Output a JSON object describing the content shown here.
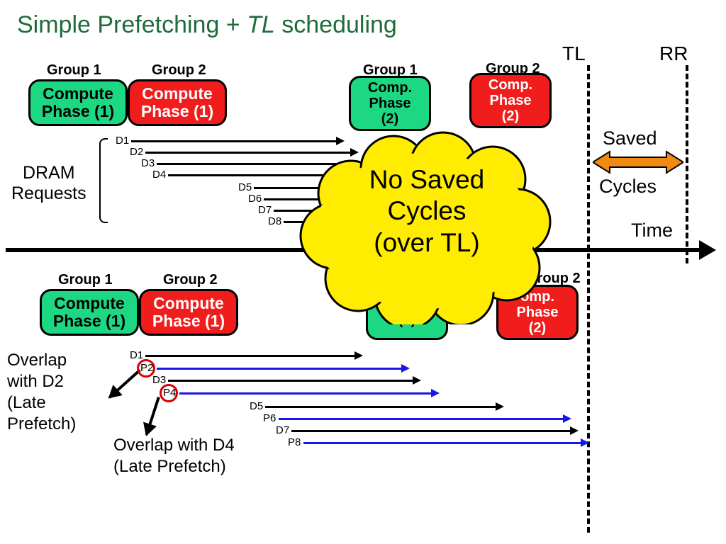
{
  "title_prefix": "Simple Prefetching + ",
  "title_italic": "TL",
  "title_suffix": " scheduling",
  "labels": {
    "group1": "Group 1",
    "group2": "Group 2",
    "compute_phase_1": "Compute Phase (1)",
    "comp_phase_2_a": "Comp.",
    "comp_phase_2_b": "Phase",
    "comp_phase_2_c": "(2)",
    "tl": "TL",
    "rr": "RR",
    "saved": "Saved",
    "cycles": "Cycles",
    "time": "Time",
    "dram": "DRAM",
    "requests": "Requests",
    "overlap_d2_a": "Overlap",
    "overlap_d2_b": "with D2",
    "overlap_d2_c": "(Late",
    "overlap_d2_d": "Prefetch)",
    "overlap_d4_a": "Overlap with D4",
    "overlap_d4_b": "(Late Prefetch)",
    "no_saved_a": "No Saved",
    "no_saved_b": "Cycles",
    "no_saved_c": "(over TL)"
  },
  "dram_top": [
    "D1",
    "D2",
    "D3",
    "D4",
    "D5",
    "D6",
    "D7",
    "D8"
  ],
  "dram_bottom": [
    "D1",
    "P2",
    "D3",
    "P4",
    "D5",
    "P6",
    "D7",
    "P8"
  ]
}
